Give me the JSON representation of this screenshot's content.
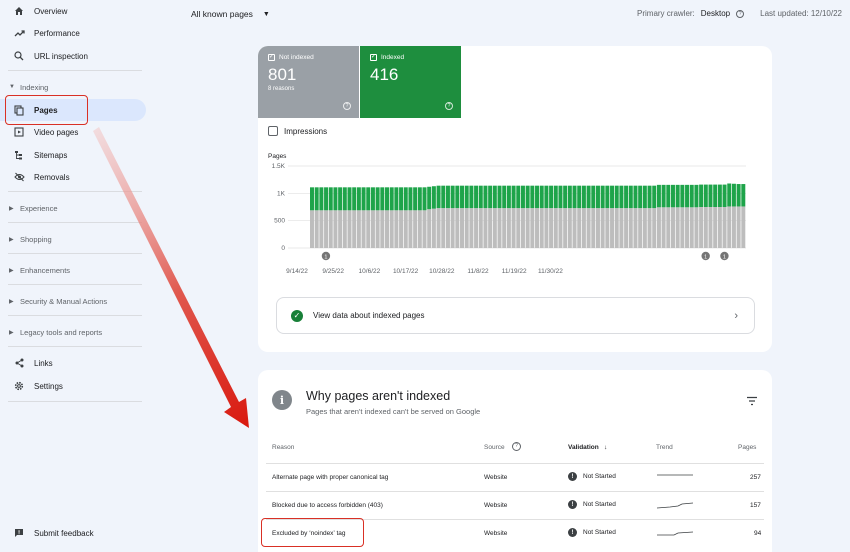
{
  "sidebar": {
    "overview": "Overview",
    "performance": "Performance",
    "url_inspection": "URL inspection",
    "indexing_header": "Indexing",
    "pages": "Pages",
    "video_pages": "Video pages",
    "sitemaps": "Sitemaps",
    "removals": "Removals",
    "experience": "Experience",
    "shopping": "Shopping",
    "enhancements": "Enhancements",
    "security": "Security & Manual Actions",
    "legacy": "Legacy tools and reports",
    "links": "Links",
    "settings": "Settings",
    "feedback": "Submit feedback"
  },
  "topbar": {
    "filter_label": "All known pages",
    "crawler_label": "Primary crawler:",
    "crawler_value": "Desktop",
    "updated": "Last updated: 12/10/22"
  },
  "summary": {
    "not_indexed_label": "Not indexed",
    "not_indexed_value": "801",
    "not_indexed_sub": "8 reasons",
    "indexed_label": "Indexed",
    "indexed_value": "416",
    "impressions_label": "Impressions",
    "view_data": "View data about indexed pages"
  },
  "colors": {
    "not_indexed": "#9aa0a6",
    "indexed": "#1e8e3e",
    "bar_gray": "#bdbdbd",
    "bar_green": "#1ea44a",
    "highlight": "#d93025"
  },
  "chart_data": {
    "type": "bar",
    "stacked": true,
    "title": "",
    "ylabel": "Pages",
    "ylim": [
      0,
      1500
    ],
    "yticks": [
      "1.5K",
      "1K",
      "500",
      "0"
    ],
    "xtick_labels": [
      "9/14/22",
      "9/25/22",
      "10/6/22",
      "10/17/22",
      "10/28/22",
      "11/8/22",
      "11/19/22",
      "11/30/22"
    ],
    "series": [
      {
        "name": "Not indexed",
        "values": [
          690,
          690,
          690,
          690,
          690,
          690,
          690,
          690,
          690,
          690,
          690,
          690,
          690,
          690,
          690,
          690,
          690,
          690,
          690,
          690,
          690,
          690,
          690,
          690,
          690,
          710,
          720,
          730,
          730,
          730,
          730,
          730,
          730,
          730,
          730,
          730,
          730,
          730,
          730,
          730,
          730,
          730,
          730,
          730,
          730,
          730,
          730,
          730,
          730,
          730,
          730,
          730,
          730,
          730,
          730,
          730,
          730,
          730,
          730,
          730,
          730,
          730,
          730,
          730,
          730,
          730,
          730,
          730,
          730,
          730,
          730,
          730,
          730,
          730,
          745,
          745,
          745,
          745,
          745,
          745,
          745,
          745,
          745,
          750,
          750,
          750,
          750,
          750,
          750,
          760,
          760,
          760,
          760
        ]
      },
      {
        "name": "Indexed",
        "values": [
          420,
          420,
          420,
          420,
          420,
          420,
          420,
          420,
          420,
          420,
          420,
          420,
          420,
          420,
          420,
          420,
          420,
          420,
          420,
          420,
          420,
          420,
          420,
          420,
          420,
          410,
          410,
          410,
          410,
          410,
          410,
          410,
          410,
          410,
          410,
          410,
          410,
          410,
          410,
          410,
          410,
          410,
          410,
          410,
          410,
          410,
          410,
          410,
          410,
          410,
          410,
          410,
          410,
          410,
          410,
          410,
          410,
          410,
          410,
          410,
          410,
          410,
          410,
          410,
          410,
          410,
          410,
          410,
          410,
          410,
          410,
          410,
          410,
          410,
          410,
          410,
          410,
          410,
          410,
          410,
          410,
          410,
          410,
          410,
          410,
          410,
          410,
          410,
          410,
          420,
          415,
          410,
          410
        ]
      }
    ],
    "annotations": [
      {
        "label": "1",
        "index": 3
      },
      {
        "label": "1",
        "index": 84
      },
      {
        "label": "1",
        "index": 88
      }
    ]
  },
  "why": {
    "title": "Why pages aren't indexed",
    "subtitle": "Pages that aren't indexed can't be served on Google",
    "col_reason": "Reason",
    "col_source": "Source",
    "col_validation": "Validation",
    "col_trend": "Trend",
    "col_pages": "Pages",
    "rows": [
      {
        "reason": "Alternate page with proper canonical tag",
        "source": "Website",
        "validation": "Not Started",
        "pages": "257"
      },
      {
        "reason": "Blocked due to access forbidden (403)",
        "source": "Website",
        "validation": "Not Started",
        "pages": "157"
      },
      {
        "reason": "Excluded by ‘noindex’ tag",
        "source": "Website",
        "validation": "Not Started",
        "pages": "94"
      }
    ]
  }
}
